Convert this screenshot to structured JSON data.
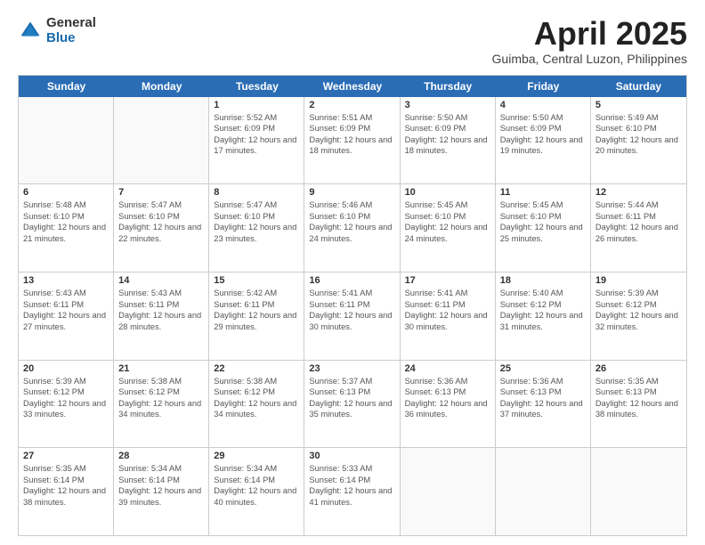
{
  "logo": {
    "general": "General",
    "blue": "Blue"
  },
  "title": "April 2025",
  "subtitle": "Guimba, Central Luzon, Philippines",
  "days_of_week": [
    "Sunday",
    "Monday",
    "Tuesday",
    "Wednesday",
    "Thursday",
    "Friday",
    "Saturday"
  ],
  "weeks": [
    [
      {
        "day": "",
        "info": ""
      },
      {
        "day": "",
        "info": ""
      },
      {
        "day": "1",
        "info": "Sunrise: 5:52 AM\nSunset: 6:09 PM\nDaylight: 12 hours and 17 minutes."
      },
      {
        "day": "2",
        "info": "Sunrise: 5:51 AM\nSunset: 6:09 PM\nDaylight: 12 hours and 18 minutes."
      },
      {
        "day": "3",
        "info": "Sunrise: 5:50 AM\nSunset: 6:09 PM\nDaylight: 12 hours and 18 minutes."
      },
      {
        "day": "4",
        "info": "Sunrise: 5:50 AM\nSunset: 6:09 PM\nDaylight: 12 hours and 19 minutes."
      },
      {
        "day": "5",
        "info": "Sunrise: 5:49 AM\nSunset: 6:10 PM\nDaylight: 12 hours and 20 minutes."
      }
    ],
    [
      {
        "day": "6",
        "info": "Sunrise: 5:48 AM\nSunset: 6:10 PM\nDaylight: 12 hours and 21 minutes."
      },
      {
        "day": "7",
        "info": "Sunrise: 5:47 AM\nSunset: 6:10 PM\nDaylight: 12 hours and 22 minutes."
      },
      {
        "day": "8",
        "info": "Sunrise: 5:47 AM\nSunset: 6:10 PM\nDaylight: 12 hours and 23 minutes."
      },
      {
        "day": "9",
        "info": "Sunrise: 5:46 AM\nSunset: 6:10 PM\nDaylight: 12 hours and 24 minutes."
      },
      {
        "day": "10",
        "info": "Sunrise: 5:45 AM\nSunset: 6:10 PM\nDaylight: 12 hours and 24 minutes."
      },
      {
        "day": "11",
        "info": "Sunrise: 5:45 AM\nSunset: 6:10 PM\nDaylight: 12 hours and 25 minutes."
      },
      {
        "day": "12",
        "info": "Sunrise: 5:44 AM\nSunset: 6:11 PM\nDaylight: 12 hours and 26 minutes."
      }
    ],
    [
      {
        "day": "13",
        "info": "Sunrise: 5:43 AM\nSunset: 6:11 PM\nDaylight: 12 hours and 27 minutes."
      },
      {
        "day": "14",
        "info": "Sunrise: 5:43 AM\nSunset: 6:11 PM\nDaylight: 12 hours and 28 minutes."
      },
      {
        "day": "15",
        "info": "Sunrise: 5:42 AM\nSunset: 6:11 PM\nDaylight: 12 hours and 29 minutes."
      },
      {
        "day": "16",
        "info": "Sunrise: 5:41 AM\nSunset: 6:11 PM\nDaylight: 12 hours and 30 minutes."
      },
      {
        "day": "17",
        "info": "Sunrise: 5:41 AM\nSunset: 6:11 PM\nDaylight: 12 hours and 30 minutes."
      },
      {
        "day": "18",
        "info": "Sunrise: 5:40 AM\nSunset: 6:12 PM\nDaylight: 12 hours and 31 minutes."
      },
      {
        "day": "19",
        "info": "Sunrise: 5:39 AM\nSunset: 6:12 PM\nDaylight: 12 hours and 32 minutes."
      }
    ],
    [
      {
        "day": "20",
        "info": "Sunrise: 5:39 AM\nSunset: 6:12 PM\nDaylight: 12 hours and 33 minutes."
      },
      {
        "day": "21",
        "info": "Sunrise: 5:38 AM\nSunset: 6:12 PM\nDaylight: 12 hours and 34 minutes."
      },
      {
        "day": "22",
        "info": "Sunrise: 5:38 AM\nSunset: 6:12 PM\nDaylight: 12 hours and 34 minutes."
      },
      {
        "day": "23",
        "info": "Sunrise: 5:37 AM\nSunset: 6:13 PM\nDaylight: 12 hours and 35 minutes."
      },
      {
        "day": "24",
        "info": "Sunrise: 5:36 AM\nSunset: 6:13 PM\nDaylight: 12 hours and 36 minutes."
      },
      {
        "day": "25",
        "info": "Sunrise: 5:36 AM\nSunset: 6:13 PM\nDaylight: 12 hours and 37 minutes."
      },
      {
        "day": "26",
        "info": "Sunrise: 5:35 AM\nSunset: 6:13 PM\nDaylight: 12 hours and 38 minutes."
      }
    ],
    [
      {
        "day": "27",
        "info": "Sunrise: 5:35 AM\nSunset: 6:14 PM\nDaylight: 12 hours and 38 minutes."
      },
      {
        "day": "28",
        "info": "Sunrise: 5:34 AM\nSunset: 6:14 PM\nDaylight: 12 hours and 39 minutes."
      },
      {
        "day": "29",
        "info": "Sunrise: 5:34 AM\nSunset: 6:14 PM\nDaylight: 12 hours and 40 minutes."
      },
      {
        "day": "30",
        "info": "Sunrise: 5:33 AM\nSunset: 6:14 PM\nDaylight: 12 hours and 41 minutes."
      },
      {
        "day": "",
        "info": ""
      },
      {
        "day": "",
        "info": ""
      },
      {
        "day": "",
        "info": ""
      }
    ]
  ]
}
